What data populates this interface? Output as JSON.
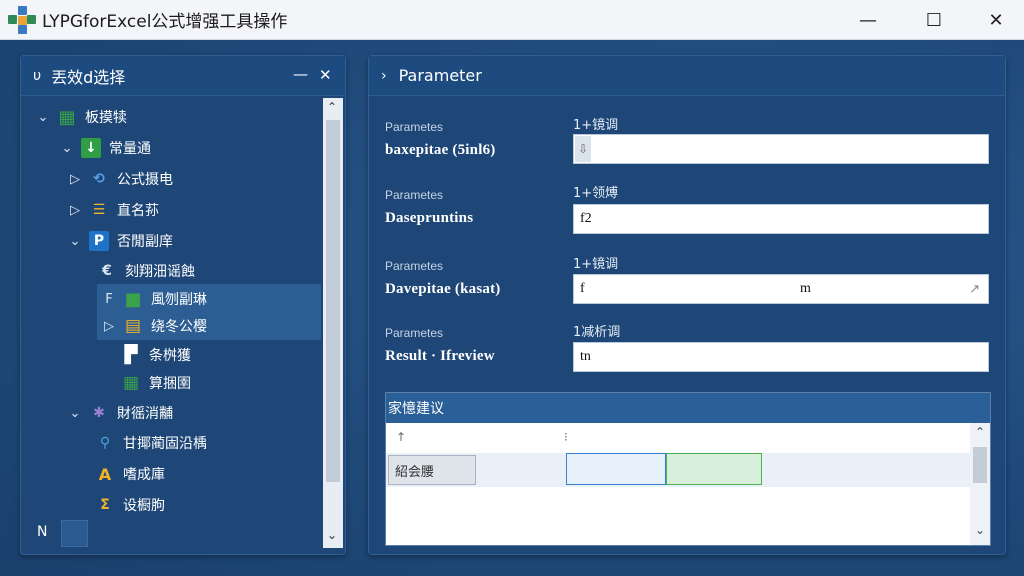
{
  "window": {
    "title": "LYPGforExcel公式增强工具操作",
    "minimize": "—",
    "maximize": "☐",
    "close": "✕"
  },
  "left_panel": {
    "title": "丟效d选择",
    "header_icon": "υ",
    "pin": "—",
    "close": "✕",
    "tree": [
      {
        "label": "板摸犊",
        "arrow": "⌄",
        "icon": "grid-icon",
        "glyph": "▦",
        "color": "#3aa24a"
      },
      {
        "label": "常量通",
        "arrow": "⌄",
        "icon": "down-arrow-icon",
        "glyph": "↓",
        "color": "#2f9e44"
      },
      {
        "label": "公式摄电",
        "arrow": "▷",
        "icon": "link-icon",
        "glyph": "⟲",
        "color": "#5aa0e6"
      },
      {
        "label": "直名荪",
        "arrow": "▷",
        "icon": "list-icon",
        "glyph": "☰",
        "color": "#f0b429"
      },
      {
        "label": "否閒副庠",
        "arrow": "⌄",
        "icon": "p-icon",
        "glyph": "P",
        "color": "#1e73c8"
      },
      {
        "label": "刻翔沺谣蝕",
        "arrow": "",
        "icon": "euro-icon",
        "glyph": "€",
        "color": "#dce7f3"
      },
      {
        "label": "風刎副琳",
        "arrow": "F",
        "icon": "box-icon",
        "glyph": "■",
        "color": "#3aa24a"
      },
      {
        "label": "绕冬公樱",
        "arrow": "▷",
        "icon": "chart-icon",
        "glyph": "▤",
        "color": "#f0b429"
      },
      {
        "label": "条桝獲",
        "arrow": "",
        "icon": "doc-icon",
        "glyph": "▛",
        "color": "#ffffff"
      },
      {
        "label": "算捆圉",
        "arrow": "",
        "icon": "table-icon",
        "glyph": "▦",
        "color": "#3aa24a"
      },
      {
        "label": "財徭消黼",
        "arrow": "⌄",
        "icon": "bug-icon",
        "glyph": "✱",
        "color": "#9b7fd6"
      },
      {
        "label": "甘揶蔺固沿楀",
        "arrow": "",
        "icon": "search-icon",
        "glyph": "⚲",
        "color": "#4aa3df"
      },
      {
        "label": "嗜成庫",
        "arrow": "",
        "icon": "a-icon",
        "glyph": "A",
        "color": "#f0b429"
      },
      {
        "label": "设橱朐",
        "arrow": "",
        "icon": "sum-icon",
        "glyph": "Σ",
        "color": "#f0b429"
      }
    ],
    "footer_label": "N"
  },
  "right_panel": {
    "title": "Parameter",
    "fields": [
      {
        "small": "Parametes",
        "label": "baxepitae (5inl6)",
        "top": "1+镜调",
        "value": ""
      },
      {
        "small": "Parametes",
        "label": "Dasepruntins",
        "top": "1+领煿",
        "value": "f2"
      },
      {
        "small": "Parametes",
        "label": "Davepitae (kasat)",
        "top": "1+镜调",
        "value": "f",
        "value_mid": "m"
      },
      {
        "small": "Parametes",
        "label": "Result · Ifreview",
        "top": "1减析调",
        "value": "tn"
      }
    ],
    "suggest": {
      "title": "家憶建议",
      "header_col1": "↑",
      "header_col2": "⁝",
      "row_label": "紹会腰"
    }
  },
  "colors": {
    "accent": "#1e4677",
    "desktop": "#1f4d80",
    "selection_blue": "#e6f0fb",
    "selection_green": "#d8efdc"
  }
}
